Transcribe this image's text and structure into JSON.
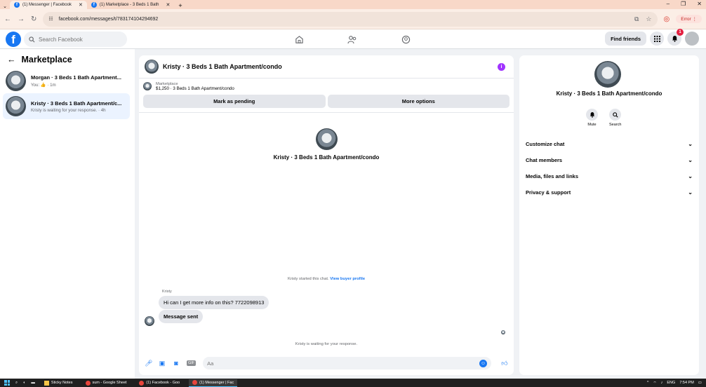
{
  "browser": {
    "tabs": [
      {
        "title": "(1) Messenger | Facebook",
        "active": true
      },
      {
        "title": "(1) Marketplace - 3 Beds 1 Bath",
        "active": false
      }
    ],
    "url": "facebook.com/messages/t/783174104294692",
    "error_label": "Error"
  },
  "fb": {
    "search_placeholder": "Search Facebook",
    "find_friends": "Find friends",
    "notifications_count": "1"
  },
  "left": {
    "title": "Marketplace",
    "conversations": [
      {
        "name": "Morgan · 3 Beds 1 Bath Apartment...",
        "preview": "You: 👍 · 1m"
      },
      {
        "name": "Kristy · 3 Beds 1 Bath Apartment/c...",
        "preview": "Kristy is waiting for your response. · 4h"
      }
    ]
  },
  "chat": {
    "header_title": "Kristy · 3 Beds 1 Bath Apartment/condo",
    "marketplace_label": "Marketplace",
    "listing": "$1,250 · 3 Beds 1 Bath Apartment/condo",
    "mark_pending": "Mark as pending",
    "more_options": "More options",
    "center_name": "Kristy · 3 Beds 1 Bath Apartment/condo",
    "started_text": "Kristy started this chat.",
    "view_buyer_profile": "View buyer profile",
    "sender_name": "Kristy",
    "message1": "Hi can I get more info on this? 7722098913",
    "message2": "Message sent",
    "waiting": "Kristy is waiting for your response.",
    "input_placeholder": "Aa"
  },
  "right": {
    "name": "Kristy · 3 Beds 1 Bath Apartment/condo",
    "mute": "Mute",
    "search": "Search",
    "rows": [
      "Customize chat",
      "Chat members",
      "Media, files and links",
      "Privacy & support"
    ]
  },
  "taskbar": {
    "items": [
      "Sticky Notes",
      "sum - Google Sheet",
      "(1) Facebook - Goo",
      "(1) Messenger | Fac"
    ],
    "lang": "ENG",
    "time": "7:54 PM"
  }
}
